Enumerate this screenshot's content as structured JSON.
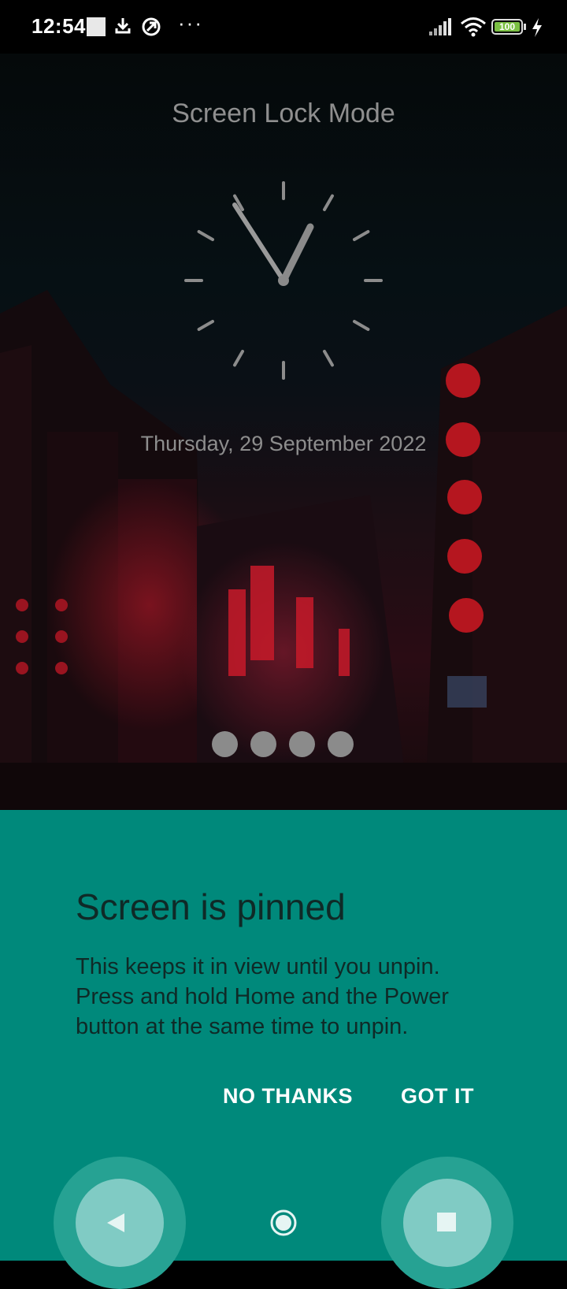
{
  "status_bar": {
    "time": "12:54",
    "battery_level": "100",
    "icons": [
      "notification-square-icon",
      "download-icon",
      "sync-icon",
      "more-dots-icon",
      "signal-icon",
      "wifi-icon",
      "battery-icon",
      "charging-icon"
    ]
  },
  "lock_screen": {
    "title": "Screen Lock Mode",
    "date": "Thursday, 29 September 2022",
    "clock_time": "12:54",
    "pin_dots": 4
  },
  "pin_dialog": {
    "title": "Screen is pinned",
    "message": "This keeps it in view until you unpin. Press and hold Home and the Power button at the same time to unpin.",
    "buttons": {
      "no_thanks": "NO THANKS",
      "got_it": "GOT IT"
    }
  },
  "navigation_bar": {
    "icons": [
      "back-icon",
      "home-icon",
      "recents-icon"
    ]
  },
  "colors": {
    "panel_bg": "#00897b",
    "nav_highlight": "#80cbc4",
    "nav_ring": "#26a293",
    "lock_text": "#8f8f8f"
  }
}
